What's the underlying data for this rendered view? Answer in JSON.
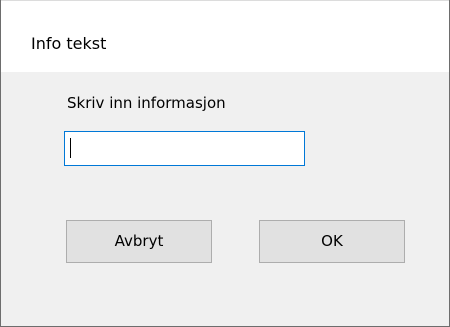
{
  "window": {
    "title": "Info tekst"
  },
  "dialog": {
    "prompt": "Skriv inn informasjon",
    "input": {
      "value": "",
      "placeholder": ""
    },
    "buttons": {
      "cancel_label": "Avbryt",
      "ok_label": "OK"
    }
  },
  "colors": {
    "input_focus_border": "#0078d7",
    "button_face": "#e1e1e1",
    "button_border": "#adadad",
    "dialog_background": "#f0f0f0",
    "titlebar_background": "#ffffff"
  }
}
